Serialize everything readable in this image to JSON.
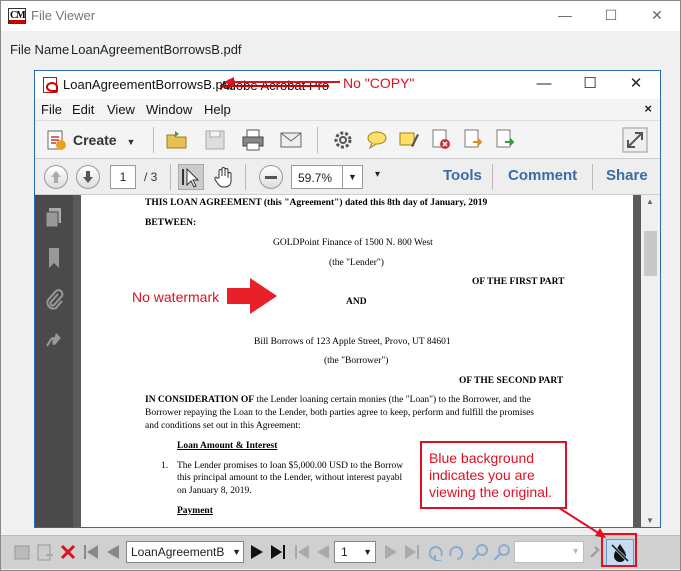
{
  "outer_window": {
    "title": "File Viewer",
    "minimize": "—",
    "maximize": "☐",
    "close": "✕",
    "file_label": "File Name",
    "file_name": "LoanAgreementBorrowsB.pdf"
  },
  "acrobat": {
    "title_file": "LoanAgreementBorrowsB.pdf",
    "title_app": "Adobe Acrobat Pro",
    "minimize": "—",
    "maximize": "☐",
    "close": "✕",
    "menu": [
      "File",
      "Edit",
      "View",
      "Window",
      "Help"
    ],
    "menu_close": "×",
    "create_label": "Create",
    "page_current": "1",
    "page_total": "/ 3",
    "zoom": "59.7%",
    "tools_label": "Tools",
    "comment_label": "Comment",
    "share_label": "Share"
  },
  "document": {
    "line1": "THIS LOAN AGREEMENT (this \"Agreement\") dated this 8th day of January, 2019",
    "between": "BETWEEN:",
    "lender_name": "GOLDPoint Finance of 1500 N. 800 West",
    "lender_tag": "(the \"Lender\")",
    "first_part": "OF THE FIRST PART",
    "and": "AND",
    "borrower_name": "Bill Borrows of 123 Apple Street, Provo, UT 84601",
    "borrower_tag": "(the \"Borrower\")",
    "second_part": "OF THE SECOND PART",
    "consideration_bold": "IN CONSIDERATION OF",
    "consideration_rest": " the Lender loaning certain monies (the \"Loan\") to the Borrower, and the",
    "consideration_2": "Borrower repaying the Loan to the Lender, both parties agree to keep, perform and fulfill the promises",
    "consideration_3": "and conditions set out in this Agreement:",
    "heading_amount": "Loan Amount & Interest",
    "item1_num": "1.",
    "item1_l1": "The Lender promises to loan $5,000.00 USD to the Borrow",
    "item1_l2": "this principal amount to the Lender, without interest payabl",
    "item1_l3": "on January 8, 2019.",
    "heading_payment": "Payment"
  },
  "bottom_bar": {
    "file_select": "LoanAgreementB",
    "page_select": "1"
  },
  "annotations": {
    "no_copy": "No \"COPY\"",
    "no_watermark": "No watermark",
    "callout": "Blue background indicates you are viewing the original."
  },
  "colors": {
    "accent_red": "#d12222",
    "acrobat_link": "#3d6aa7",
    "watermark_button": "#c6dcf3"
  }
}
